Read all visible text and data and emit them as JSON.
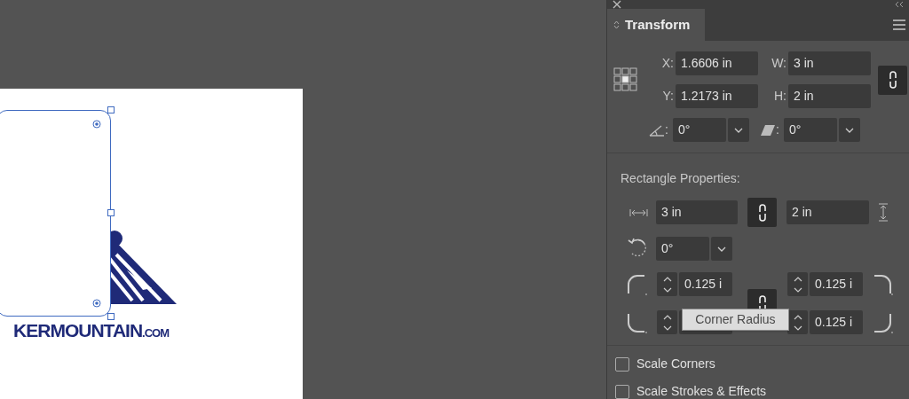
{
  "canvas": {
    "logo_text": "KERMOUNTAIN",
    "logo_suffix": ".COM"
  },
  "panel": {
    "tab": {
      "label": "Transform",
      "selected": true
    },
    "position_fields": [
      {
        "label": "X:",
        "value": "1.6606 in"
      },
      {
        "label": "W:",
        "value": "3 in"
      },
      {
        "label": "Y:",
        "value": "1.2173 in"
      },
      {
        "label": "H:",
        "value": "2 in"
      }
    ],
    "angle_fields": [
      {
        "kind": "rotate",
        "label": ":",
        "value": "0°"
      },
      {
        "kind": "shear",
        "label": ":",
        "value": "0°"
      }
    ],
    "rectangle_properties": {
      "title": "Rectangle Properties:",
      "width": "3 in",
      "height": "2 in",
      "rotation": "0°",
      "corners": [
        {
          "kind": "top-left",
          "value": "0.125 i"
        },
        {
          "kind": "top-right",
          "value": "0.125 i"
        },
        {
          "kind": "bottom-left"
        },
        {
          "kind": "bottom-right",
          "value": "0.125 i"
        }
      ]
    },
    "tooltip": "Corner Radius",
    "checkboxes": [
      {
        "label": "Scale Corners",
        "checked": false
      },
      {
        "label": "Scale Strokes & Effects",
        "checked": false
      }
    ]
  }
}
